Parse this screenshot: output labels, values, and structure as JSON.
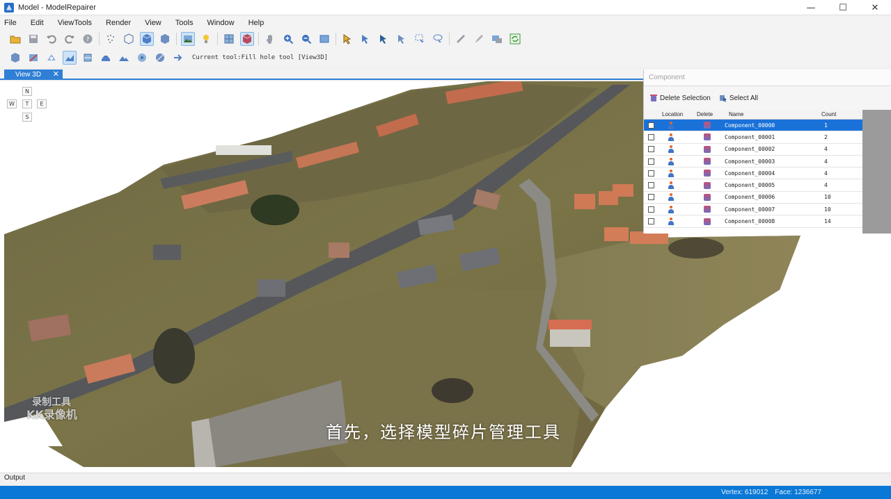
{
  "window": {
    "title": "Model - ModelRepairer",
    "minimize": "—",
    "maximize": "☐",
    "close": "✕"
  },
  "menu": [
    "File",
    "Edit",
    "ViewTools",
    "Render",
    "View",
    "Tools",
    "Window",
    "Help"
  ],
  "toolbar": {
    "current_tool": "Current tool:Fill hole tool [View3D]"
  },
  "doc_tab": {
    "label": "View 3D",
    "close": "✕"
  },
  "compass": {
    "north": "N",
    "west": "W",
    "top": "T",
    "east": "E",
    "south": "S"
  },
  "component_panel": {
    "title": "Component",
    "delete_selection": "Delete Selection",
    "select_all": "Select All",
    "columns": [
      "Location",
      "Delete",
      "Name",
      "Count"
    ],
    "rows": [
      {
        "name": "Component_00000",
        "count": "1",
        "selected": true
      },
      {
        "name": "Component_00001",
        "count": "2",
        "selected": false
      },
      {
        "name": "Component_00002",
        "count": "4",
        "selected": false
      },
      {
        "name": "Component_00003",
        "count": "4",
        "selected": false
      },
      {
        "name": "Component_00004",
        "count": "4",
        "selected": false
      },
      {
        "name": "Component_00005",
        "count": "4",
        "selected": false
      },
      {
        "name": "Component_00006",
        "count": "10",
        "selected": false
      },
      {
        "name": "Component_00007",
        "count": "10",
        "selected": false
      },
      {
        "name": "Component_00008",
        "count": "14",
        "selected": false
      }
    ]
  },
  "subtitle": "首先，选择模型碎片管理工具",
  "watermark": {
    "line1": "录制工具",
    "line2": "KK录像机"
  },
  "output": {
    "label": "Output"
  },
  "status": {
    "vertex": "Vertex: 619012",
    "face": "Face: 1236677"
  },
  "colors": {
    "accent": "#2f7fd5",
    "status_bar": "#0a78d7",
    "selection": "#1a72d9"
  }
}
